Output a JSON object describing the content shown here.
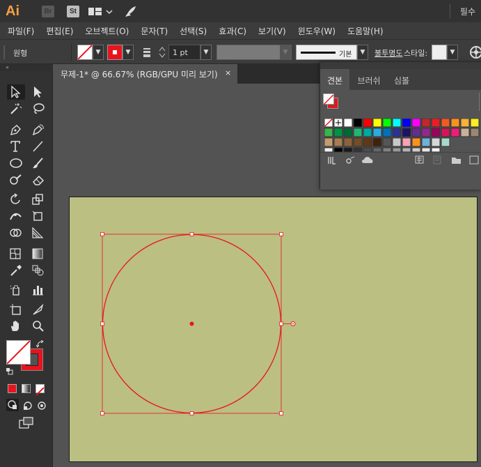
{
  "titlebar": {
    "app_logo": "Ai",
    "bridge_badge": "Br",
    "stock_badge": "St",
    "essentials": "필수"
  },
  "menu": [
    "파일(F)",
    "편집(E)",
    "오브젝트(O)",
    "문자(T)",
    "선택(S)",
    "효과(C)",
    "보기(V)",
    "윈도우(W)",
    "도움말(H)"
  ],
  "controlbar": {
    "shape_label": "원형",
    "stroke_weight": "1 pt",
    "stroke_profile": "기본",
    "opacity_label": "불투명도",
    "style_label": "스타일:",
    "fill_color": "#ffffff",
    "stroke_color": "#e8141d"
  },
  "document": {
    "tab_title": "무제-1* @ 66.67% (RGB/GPU 미리 보기)",
    "close": "×",
    "artboard_color": "#bbbf82"
  },
  "swatches_panel": {
    "tabs": [
      "견본",
      "브러쉬",
      "심볼"
    ],
    "active_tab": 0
  },
  "colors": {
    "ui_dark": "#323232",
    "ui_mid": "#535353",
    "accent_red": "#e8141d",
    "logo_orange": "#f7a041"
  }
}
